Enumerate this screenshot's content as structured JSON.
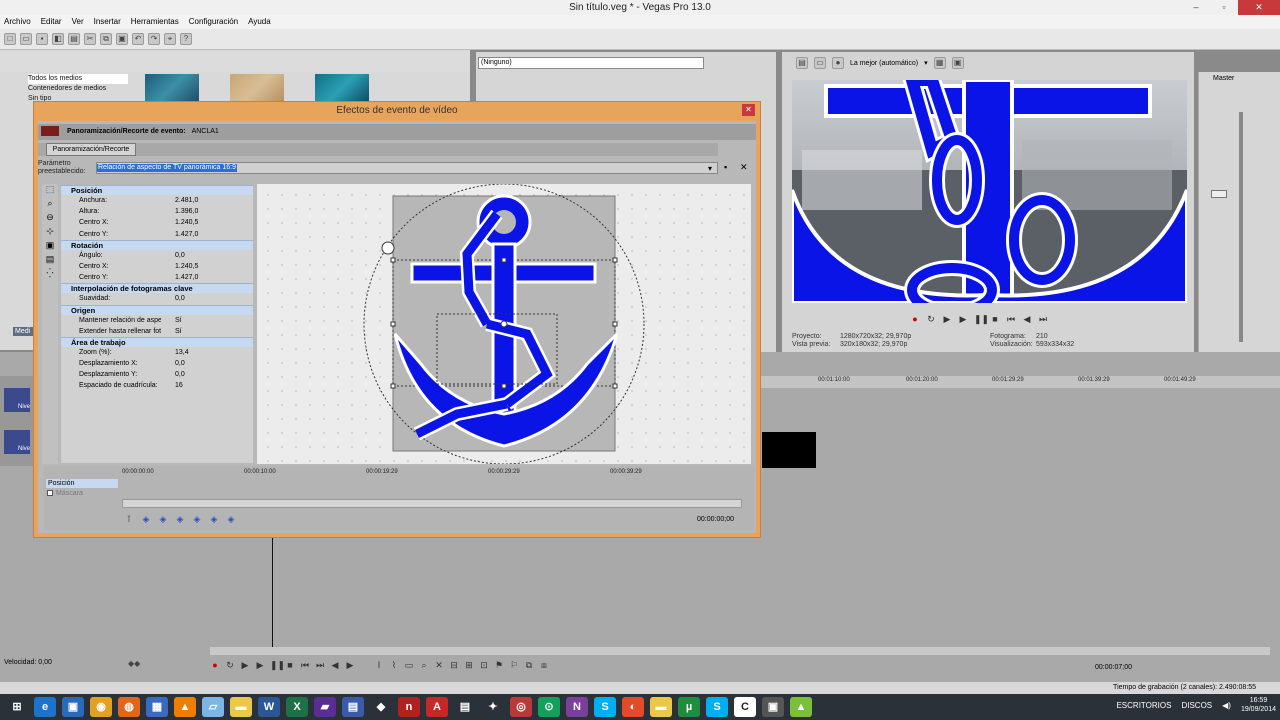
{
  "window": {
    "title": "Sin título.veg * - Vegas Pro 13.0"
  },
  "menu": [
    "Archivo",
    "Editar",
    "Ver",
    "Insertar",
    "Herramientas",
    "Configuración",
    "Ayuda"
  ],
  "explorer": {
    "tree": [
      "Todos los medios",
      "Contenedores de medios",
      "Sin tipo"
    ],
    "media_tab": "Medi"
  },
  "plugin_chooser": {
    "value": "(Ninguno)"
  },
  "preview": {
    "quality": "La mejor (automático)",
    "proyecto_label": "Proyecto:",
    "proyecto_value": "1280x720x32; 29,970p",
    "vista_label": "Vista previa:",
    "vista_value": "320x180x32; 29,970p",
    "fotograma_label": "Fotograma:",
    "fotograma_value": "210",
    "visualizacion_label": "Visualización:",
    "visualizacion_value": "593x334x32"
  },
  "master": {
    "label": "Master"
  },
  "timeline": {
    "ticks": [
      "00:01:10:00",
      "00:01:20:00",
      "00:01:29:29",
      "00:01:39:29",
      "00:01:49:29"
    ],
    "track_labels": [
      "Nive",
      "Nive"
    ]
  },
  "status": {
    "velocidad": "Velocidad: 0,00",
    "timecode": "00:00:07;00",
    "grabacion": "Tiempo de grabación (2 canales): 2.490:08:55"
  },
  "taskbar": {
    "tray1": "ESCRITORIOS",
    "tray2": "DISCOS",
    "time": "16:59",
    "date": "19/09/2014"
  },
  "dialog": {
    "title": "Efectos de evento de vídeo",
    "header_label": "Panoramización/Recorte de evento:",
    "header_value": "ANCLA1",
    "tab": "Panoramización/Recorte",
    "preset_label_1": "Parámetro",
    "preset_label_2": "preestablecido:",
    "preset_value": "Relación de aspecto de TV panorámica 16:9",
    "sections": [
      {
        "title": "Posición",
        "rows": [
          [
            "Anchura:",
            "2.481,0"
          ],
          [
            "Altura:",
            "1.396,0"
          ],
          [
            "Centro X:",
            "1.240,5"
          ],
          [
            "Centro Y:",
            "1.427,0"
          ]
        ]
      },
      {
        "title": "Rotación",
        "rows": [
          [
            "Ángulo:",
            "0,0"
          ],
          [
            "Centro X:",
            "1.240,5"
          ],
          [
            "Centro Y:",
            "1.427,0"
          ]
        ]
      },
      {
        "title": "Interpolación de fotogramas clave",
        "rows": [
          [
            "Suavidad:",
            "0,0"
          ]
        ]
      },
      {
        "title": "Origen",
        "rows": [
          [
            "Mantener relación de aspec...",
            "Sí"
          ],
          [
            "Extender hasta rellenar fot...",
            "Sí"
          ]
        ]
      },
      {
        "title": "Área de trabajo",
        "rows": [
          [
            "Zoom (%):",
            "13,4"
          ],
          [
            "Desplazamiento X:",
            "0,0"
          ],
          [
            "Desplazamiento Y:",
            "0,0"
          ],
          [
            "Espaciado de cuadrícula:",
            "16"
          ]
        ]
      }
    ],
    "kf_ticks": [
      "00:00:00:00",
      "00:00:10:00",
      "00:00:19:29",
      "00:00:29:29",
      "00:00:39:29"
    ],
    "kf_row1": "Posición",
    "kf_row2": "Máscara",
    "kf_time": "00:00:00;00"
  },
  "colors": {
    "anchor": "#0a14e6",
    "dialog_frame": "#e8a45a",
    "section": "#c6d9f0",
    "highlight": "#2a6ed8"
  }
}
